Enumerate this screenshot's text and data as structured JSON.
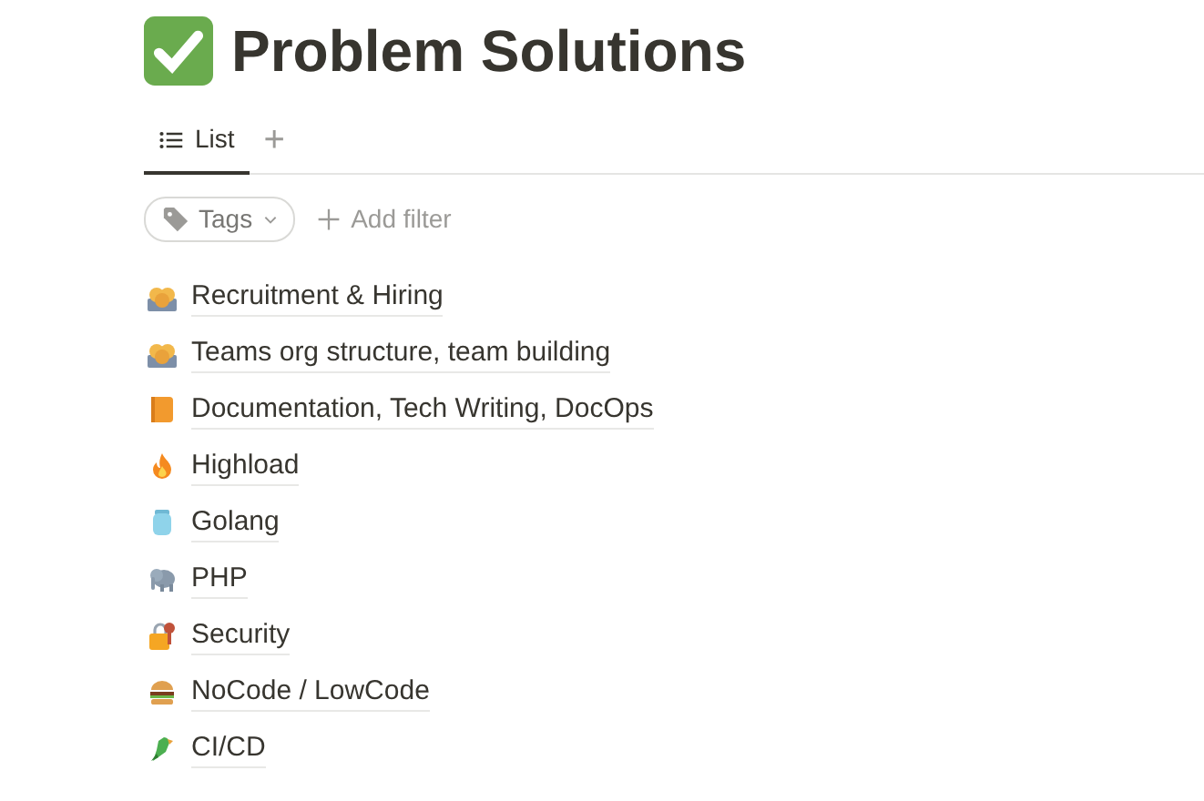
{
  "page": {
    "title": "Problem Solutions"
  },
  "views": [
    {
      "label": "List",
      "selected": true
    }
  ],
  "add_view": "+",
  "filters": [
    {
      "kind": "chip",
      "label": "Tags"
    },
    {
      "kind": "add",
      "label": "Add filter"
    }
  ],
  "items": [
    {
      "title": "Recruitment & Hiring",
      "kind": "people"
    },
    {
      "title": "Teams org structure, team building",
      "kind": "people"
    },
    {
      "title": "Documentation, Tech Writing, DocOps",
      "kind": "book"
    },
    {
      "title": "Highload",
      "kind": "fire"
    },
    {
      "title": "Golang",
      "kind": "jar"
    },
    {
      "title": "PHP",
      "kind": "elephant"
    },
    {
      "title": "Security",
      "kind": "lock"
    },
    {
      "title": "NoCode / LowCode",
      "kind": "burger"
    },
    {
      "title": "CI/CD",
      "kind": "parrot"
    }
  ]
}
